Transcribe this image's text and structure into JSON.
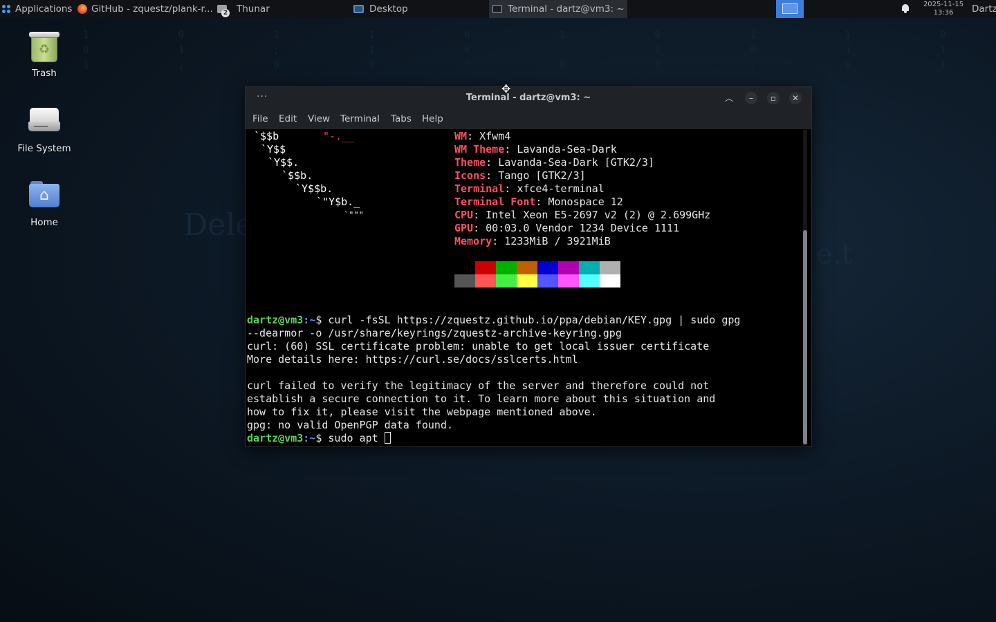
{
  "panel": {
    "applications": "Applications",
    "tasks": [
      {
        "label": "GitHub - zquestz/plank-r...",
        "icon": "firefox-icon"
      },
      {
        "label": "Thunar",
        "icon": "file-manager-icon",
        "badge": "2"
      },
      {
        "label": "Desktop",
        "icon": "desktop-icon"
      },
      {
        "label": "Terminal - dartz@vm3: ~",
        "icon": "terminal-icon",
        "active": true
      }
    ],
    "date": "2025-11-15",
    "time": "13:36",
    "user": "Dartz"
  },
  "desktop": {
    "icons": [
      {
        "label": "Trash",
        "icon": "trash-icon"
      },
      {
        "label": "File System",
        "icon": "drive-icon"
      },
      {
        "label": "Home",
        "icon": "home-folder-icon"
      }
    ]
  },
  "terminal": {
    "title": "Terminal - dartz@vm3: ~",
    "menu": [
      "File",
      "Edit",
      "View",
      "Terminal",
      "Tabs",
      "Help"
    ],
    "logo": [
      "`$$b",
      "`Y$$",
      "`Y$$.",
      "`$$b.",
      "`Y$$b.",
      "`\"Y$b._",
      "`\"\"\""
    ],
    "logo_accent": "\"-.__",
    "info": [
      {
        "key": "WM",
        "value": "Xfwm4"
      },
      {
        "key": "WM Theme",
        "value": "Lavanda-Sea-Dark"
      },
      {
        "key": "Theme",
        "value": "Lavanda-Sea-Dark [GTK2/3]"
      },
      {
        "key": "Icons",
        "value": "Tango [GTK2/3]"
      },
      {
        "key": "Terminal",
        "value": "xfce4-terminal"
      },
      {
        "key": "Terminal Font",
        "value": "Monospace 12"
      },
      {
        "key": "CPU",
        "value": "Intel Xeon E5-2697 v2 (2) @ 2.699GHz"
      },
      {
        "key": "GPU",
        "value": "00:03.0 Vendor 1234 Device 1111"
      },
      {
        "key": "Memory",
        "value": "1233MiB / 3921MiB"
      }
    ],
    "palette_top": [
      "#000000",
      "#cc0000",
      "#00b000",
      "#c06000",
      "#0000d0",
      "#b000b0",
      "#00b0b0",
      "#b0b0b0"
    ],
    "palette_bottom": [
      "#555555",
      "#ff5555",
      "#44ee44",
      "#ffff44",
      "#5555ff",
      "#ff55ff",
      "#55ffff",
      "#ffffff"
    ],
    "prompt_user": "dartz@vm3",
    "prompt_path": ":~",
    "prompt_symbol": "$ ",
    "command1": "curl -fsSL https://zquestz.github.io/ppa/debian/KEY.gpg | sudo gpg",
    "output": [
      "--dearmor -o /usr/share/keyrings/zquestz-archive-keyring.gpg",
      "curl: (60) SSL certificate problem: unable to get local issuer certificate",
      "More details here: https://curl.se/docs/sslcerts.html",
      "",
      "curl failed to verify the legitimacy of the server and therefore could not",
      "establish a secure connection to it. To learn more about this situation and",
      "how to fix it, please visit the webpage mentioned above.",
      "gpg: no valid OpenPGP data found."
    ],
    "command2": "sudo apt "
  }
}
